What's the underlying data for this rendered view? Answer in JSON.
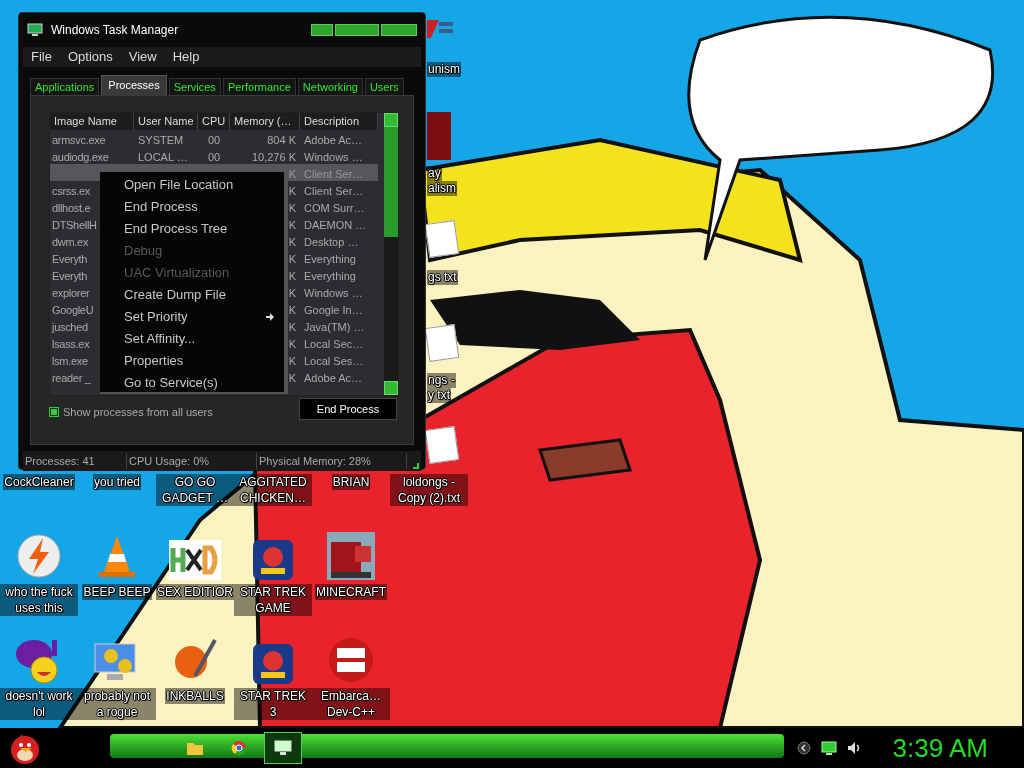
{
  "task_manager": {
    "title": "Windows Task Manager",
    "menu": [
      "File",
      "Options",
      "View",
      "Help"
    ],
    "tabs": [
      {
        "label": "Applications",
        "selected": false
      },
      {
        "label": "Processes",
        "selected": true
      },
      {
        "label": "Services",
        "selected": false
      },
      {
        "label": "Performance",
        "selected": false
      },
      {
        "label": "Networking",
        "selected": false
      },
      {
        "label": "Users",
        "selected": false
      }
    ],
    "table": {
      "columns": [
        "Image Name",
        "User Name",
        "CPU",
        "Memory (…",
        "Description"
      ],
      "rows": [
        {
          "selected": false,
          "cells": [
            "armsvc.exe",
            "SYSTEM",
            "00",
            "804 K",
            "Adobe Ac…"
          ]
        },
        {
          "selected": false,
          "cells": [
            "audiodg.exe",
            "LOCAL …",
            "00",
            "10,276 K",
            "Windows …"
          ]
        },
        {
          "selected": true,
          "cells": [
            "",
            "",
            "",
            "K",
            "Client Ser…"
          ]
        },
        {
          "selected": false,
          "cells": [
            "csrss.ex",
            "",
            "",
            "K",
            "Client Ser…"
          ]
        },
        {
          "selected": false,
          "cells": [
            "dllhost.e",
            "",
            "",
            "K",
            "COM Surr…"
          ]
        },
        {
          "selected": false,
          "cells": [
            "DTShellH",
            "",
            "",
            "K",
            "DAEMON …"
          ]
        },
        {
          "selected": false,
          "cells": [
            "dwm.ex",
            "",
            "",
            "K",
            "Desktop …"
          ]
        },
        {
          "selected": false,
          "cells": [
            "Everyth",
            "",
            "",
            "K",
            "Everything"
          ]
        },
        {
          "selected": false,
          "cells": [
            "Everyth",
            "",
            "",
            "K",
            "Everything"
          ]
        },
        {
          "selected": false,
          "cells": [
            "explorer",
            "",
            "",
            "K",
            "Windows …"
          ]
        },
        {
          "selected": false,
          "cells": [
            "GoogleU",
            "",
            "",
            "K",
            "Google In…"
          ]
        },
        {
          "selected": false,
          "cells": [
            "jusched",
            "",
            "",
            "K",
            "Java(TM) …"
          ]
        },
        {
          "selected": false,
          "cells": [
            "lsass.ex",
            "",
            "",
            "K",
            "Local Sec…"
          ]
        },
        {
          "selected": false,
          "cells": [
            "lsm.exe",
            "",
            "",
            "K",
            "Local Ses…"
          ]
        },
        {
          "selected": false,
          "cells": [
            "reader _",
            "",
            "",
            "K",
            "Adobe Ac…"
          ]
        }
      ]
    },
    "show_all_users": {
      "label": "Show processes from all users",
      "checked": true
    },
    "end_button": "End Process",
    "status_bar": [
      "Processes: 41",
      "CPU Usage: 0%",
      "Physical Memory: 28%"
    ]
  },
  "context_menu": [
    {
      "label": "Open File Location",
      "disabled": false,
      "submenu": false
    },
    {
      "label": "End Process",
      "disabled": false,
      "submenu": false
    },
    {
      "label": "End Process Tree",
      "disabled": false,
      "submenu": false
    },
    {
      "label": "Debug",
      "disabled": true,
      "submenu": false
    },
    {
      "label": "UAC Virtualization",
      "disabled": true,
      "submenu": false
    },
    {
      "label": "Create Dump File",
      "disabled": false,
      "submenu": false
    },
    {
      "label": "Set Priority",
      "disabled": false,
      "submenu": true
    },
    {
      "label": "Set Affinity...",
      "disabled": false,
      "submenu": false
    },
    {
      "label": "Properties",
      "disabled": false,
      "submenu": false
    },
    {
      "label": "Go to Service(s)",
      "disabled": false,
      "submenu": false
    }
  ],
  "partial_icon_labels": [
    [
      "unism"
    ],
    [
      "ay",
      "alism"
    ],
    [
      "gs txt"
    ],
    [
      "ngs -",
      "y txt"
    ]
  ],
  "desktop_icons": [
    {
      "label": "CockCleaner",
      "kind": "hidden"
    },
    {
      "label": "you tried",
      "kind": "hidden"
    },
    {
      "label": "GO GO GADGET …",
      "kind": "hidden"
    },
    {
      "label": "AGGITATED CHICKEN…",
      "kind": "hidden"
    },
    {
      "label": "BRIAN",
      "kind": "hidden"
    },
    {
      "label": "loldongs - Copy (2).txt",
      "kind": "hidden"
    },
    {
      "label": "who the fuck uses this",
      "kind": "bolt"
    },
    {
      "label": "BEEP BEEP",
      "kind": "cone"
    },
    {
      "label": "SEX EDITIOR",
      "kind": "hex"
    },
    {
      "label": "STAR TREK GAME",
      "kind": "game"
    },
    {
      "label": "MINECRAFT",
      "kind": "block"
    },
    {
      "kind": "none"
    },
    {
      "label": "doesn't work lol",
      "kind": "messenger"
    },
    {
      "label": "probably not a rogue",
      "kind": "gears"
    },
    {
      "label": "INKBALLS",
      "kind": "ball"
    },
    {
      "label": "STAR TREK 3",
      "kind": "game"
    },
    {
      "label": "Embarca… Dev-C++",
      "kind": "dev"
    }
  ],
  "taskbar": {
    "apps": [
      {
        "kind": "folder",
        "selected": false
      },
      {
        "kind": "browser",
        "selected": false
      },
      {
        "kind": "monitor",
        "selected": true
      }
    ],
    "clock": "3:39 AM"
  }
}
